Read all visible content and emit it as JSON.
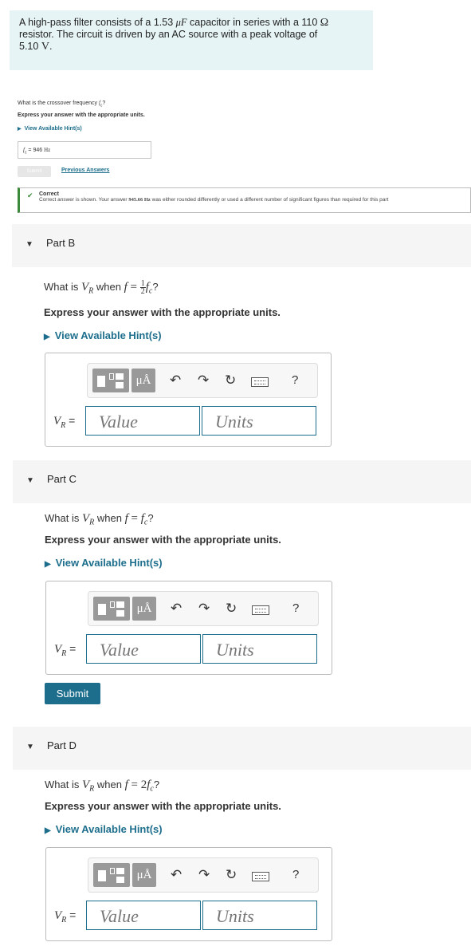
{
  "intro": {
    "line1_pre": "A high-pass filter consists of a 1.53 ",
    "line1_unit": "μF",
    "line1_mid": " capacitor in series with a 110 ",
    "line1_ohm": "Ω",
    "line2": "resistor. The circuit is driven by an AC source with a peak voltage of",
    "line3_val": "5.10 ",
    "line3_unit": "V",
    "line3_end": "."
  },
  "part_a": {
    "question": "What is the crossover frequency ",
    "question_var": "f",
    "question_sub": "c",
    "question_end": "?",
    "instruction": "Express your answer with the appropriate units.",
    "hint": "View Available Hint(s)",
    "answer_label": "f",
    "answer_sub": "c",
    "answer_eq": " = ",
    "answer_value": "946 ",
    "answer_unit": "Hz",
    "submit": "Submit",
    "previous_answers": "Previous Answers",
    "status_title": "Correct",
    "status_text_pre": "Correct answer is shown. Your answer ",
    "status_value": "945.66 Hz",
    "status_text_post": " was either rounded differently or used a different number of significant figures than required for this part"
  },
  "parts": [
    {
      "label": "Part B",
      "q_pre": "What is ",
      "q_var": "V",
      "q_sub": "R",
      "q_when": " when ",
      "q_f": "f",
      "q_eq": " = ",
      "q_num": "1",
      "q_den": "2",
      "q_rhs": "f",
      "q_rhs_sub": "c",
      "q_end": "?",
      "instruction": "Express your answer with the appropriate units.",
      "hint": "View Available Hint(s)",
      "var_label": "V",
      "var_sub": "R",
      "eq": " =",
      "value_placeholder": "Value",
      "units_placeholder": "Units"
    },
    {
      "label": "Part C",
      "q_pre": "What is ",
      "q_var": "V",
      "q_sub": "R",
      "q_when": " when ",
      "q_f": "f",
      "q_eq": " = ",
      "q_rhs": "f",
      "q_rhs_sub": "c",
      "q_end": "?",
      "instruction": "Express your answer with the appropriate units.",
      "hint": "View Available Hint(s)",
      "var_label": "V",
      "var_sub": "R",
      "eq": " =",
      "value_placeholder": "Value",
      "units_placeholder": "Units",
      "submit": "Submit"
    },
    {
      "label": "Part D",
      "q_pre": "What is ",
      "q_var": "V",
      "q_sub": "R",
      "q_when": " when ",
      "q_f": "f",
      "q_eq": " = ",
      "q_coef": "2",
      "q_rhs": "f",
      "q_rhs_sub": "c",
      "q_end": "?",
      "instruction": "Express your answer with the appropriate units.",
      "hint": "View Available Hint(s)",
      "var_label": "V",
      "var_sub": "R",
      "eq": " =",
      "value_placeholder": "Value",
      "units_placeholder": "Units"
    }
  ],
  "toolbar": {
    "units_button": "μÅ",
    "undo": "↶",
    "redo": "↷",
    "reset": "↻",
    "help": "?",
    "icons": [
      "templates-icon",
      "units-icon",
      "undo-icon",
      "redo-icon",
      "reset-icon",
      "keyboard-icon",
      "help-icon"
    ]
  },
  "colors": {
    "intro_bg": "#e6f4f5",
    "link": "#1d6e8c",
    "submit_bg": "#1d6e8c",
    "correct": "#3a8a3a",
    "part_header_bg": "#f5f5f5"
  }
}
